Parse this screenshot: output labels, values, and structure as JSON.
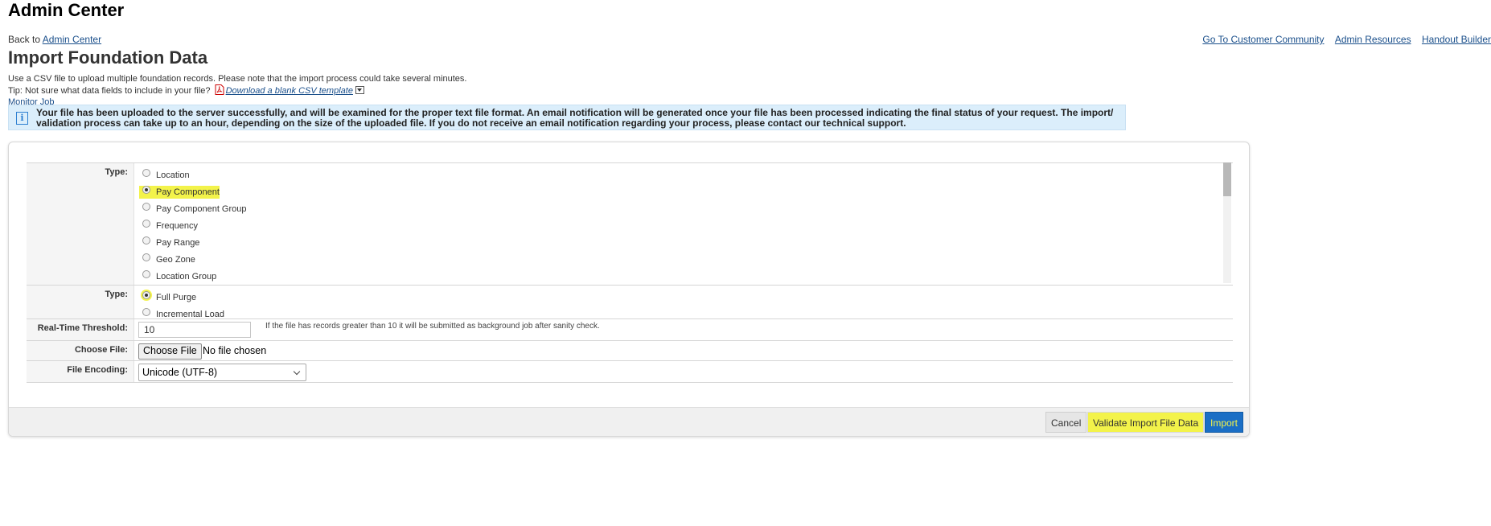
{
  "app": {
    "title": "Admin Center"
  },
  "back": {
    "prefix": "Back to",
    "link": "Admin Center"
  },
  "top_links": [
    "Go To Customer Community",
    "Admin Resources",
    "Handout Builder"
  ],
  "page": {
    "title": "Import Foundation Data",
    "description": "Use a CSV file to upload multiple foundation records. Please note that the import process could take several minutes.",
    "tip": " Tip: Not sure what data fields to include in your file?",
    "download_link": "Download a blank CSV template",
    "monitor_link": "Monitor Job"
  },
  "info": {
    "icon": "info-icon",
    "text": "Your file has been uploaded to the server successfully, and will be examined for the proper text file format. An email notification will be generated once your file has been processed indicating the final status of your request. The import/ validation process can take up to an hour, depending on the size of the uploaded file. If you do not receive an email notification regarding your process, please contact our technical support."
  },
  "form": {
    "type_label": "Type:",
    "type_options": [
      "Location",
      "Pay Component",
      "Pay Component Group",
      "Frequency",
      "Pay Range",
      "Geo Zone",
      "Location Group"
    ],
    "type_selected": "Pay Component",
    "mode_label": "Type:",
    "mode_options": [
      "Full Purge",
      "Incremental Load"
    ],
    "mode_selected": "Full Purge",
    "threshold_label": "Real-Time Threshold:",
    "threshold_value": "10",
    "threshold_note": "If the file has records greater than 10 it will be submitted as background job after sanity check.",
    "file_label": "Choose File:",
    "file_button": "Choose File",
    "file_status": "No file chosen",
    "encoding_label": "File Encoding:",
    "encoding_value": "Unicode (UTF-8)"
  },
  "footer": {
    "cancel": "Cancel",
    "validate": "Validate Import File Data",
    "import": "Import"
  },
  "colors": {
    "highlight": "#f3f34a",
    "primary": "#1a6ec5",
    "info_bg": "#dbeefb"
  }
}
